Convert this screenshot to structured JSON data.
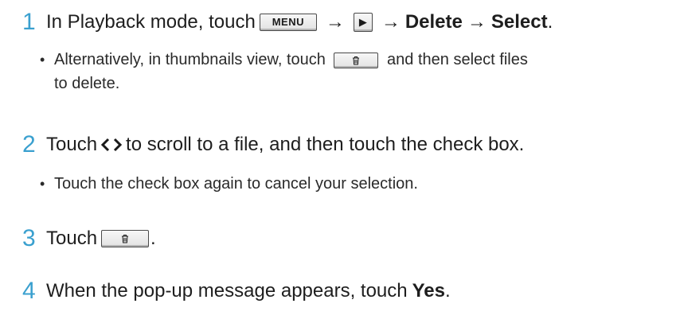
{
  "steps": [
    {
      "num": "1",
      "text_a": "In Playback mode, touch",
      "menu_label": "MENU",
      "arrow1": "→",
      "play_icon": "▶",
      "arrow2": "→",
      "delete_label": "Delete",
      "arrow3": "→",
      "select_label": "Select",
      "end": ".",
      "sub_a": "Alternatively, in thumbnails view, touch",
      "sub_b": "and then select files",
      "sub_c": "to delete."
    },
    {
      "num": "2",
      "text_a": "Touch",
      "nav_icon": "</>",
      "text_b": "to scroll to a file, and then touch the check box.",
      "sub": "Touch the check box again to cancel your selection."
    },
    {
      "num": "3",
      "text_a": "Touch",
      "end": "."
    },
    {
      "num": "4",
      "text_a": "When the pop-up message appears, touch",
      "yes_label": "Yes",
      "end": "."
    }
  ],
  "bullet": "•",
  "icons": {
    "trash": "trash-icon",
    "play": "play-icon",
    "nav": "left-right-chevron-icon"
  },
  "colors": {
    "step_number": "#3aa0cf",
    "text": "#1e1e1e"
  }
}
